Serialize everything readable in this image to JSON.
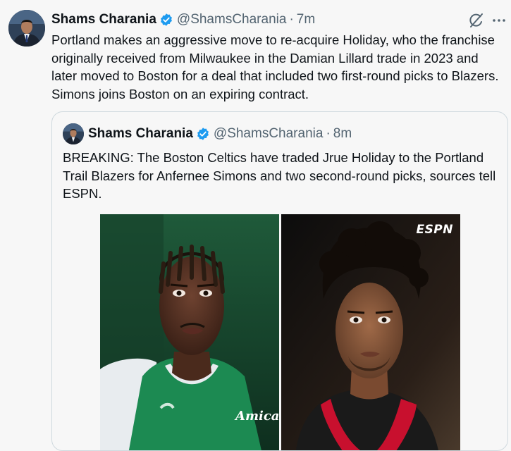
{
  "tweet": {
    "author_name": "Shams Charania",
    "handle": "@ShamsCharania",
    "separator": "·",
    "time": "7m",
    "text": "Portland makes an aggressive move to re-acquire Holiday, who the franchise originally received from Milwaukee in the Damian Lillard trade in 2023 and later moved to Boston for a deal that included two first-round picks to Blazers. Simons joins Boston on an expiring contract."
  },
  "quoted_tweet": {
    "author_name": "Shams Charania",
    "handle": "@ShamsCharania",
    "separator": "·",
    "time": "8m",
    "text": "BREAKING: The Boston Celtics have traded Jrue Holiday to the Portland Trail Blazers for Anfernee Simons and two second-round picks, sources tell ESPN.",
    "media": {
      "watermark": "ESPN",
      "left_photo_jersey_text": "Amica"
    }
  },
  "icons": {
    "verified": "verified-badge-icon",
    "grok": "grok-icon",
    "more": "more-options-icon"
  },
  "colors": {
    "verified_blue": "#1d9bf0",
    "text_primary": "#0f1419",
    "text_secondary": "#536471",
    "border": "#cfd9de"
  }
}
